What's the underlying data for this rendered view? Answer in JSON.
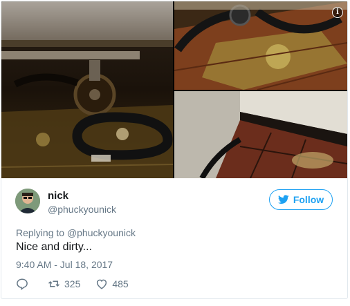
{
  "tweet": {
    "user": {
      "name": "nick",
      "handle": "@phuckyounick"
    },
    "follow_label": "Follow",
    "replying_prefix": "Replying to",
    "replying_to": "@phuckyounick",
    "text": "Nice and dirty...",
    "timestamp": "9:40 AM - Jul 18, 2017",
    "retweets": "325",
    "likes": "485"
  },
  "icons": {
    "info": "info-icon",
    "follow": "twitter-bird-icon",
    "reply": "reply-icon",
    "retweet": "retweet-icon",
    "like": "heart-icon"
  },
  "colors": {
    "accent": "#1da1f2",
    "secondary_text": "#657786",
    "primary_text": "#14171a",
    "border": "#e1e8ed"
  }
}
